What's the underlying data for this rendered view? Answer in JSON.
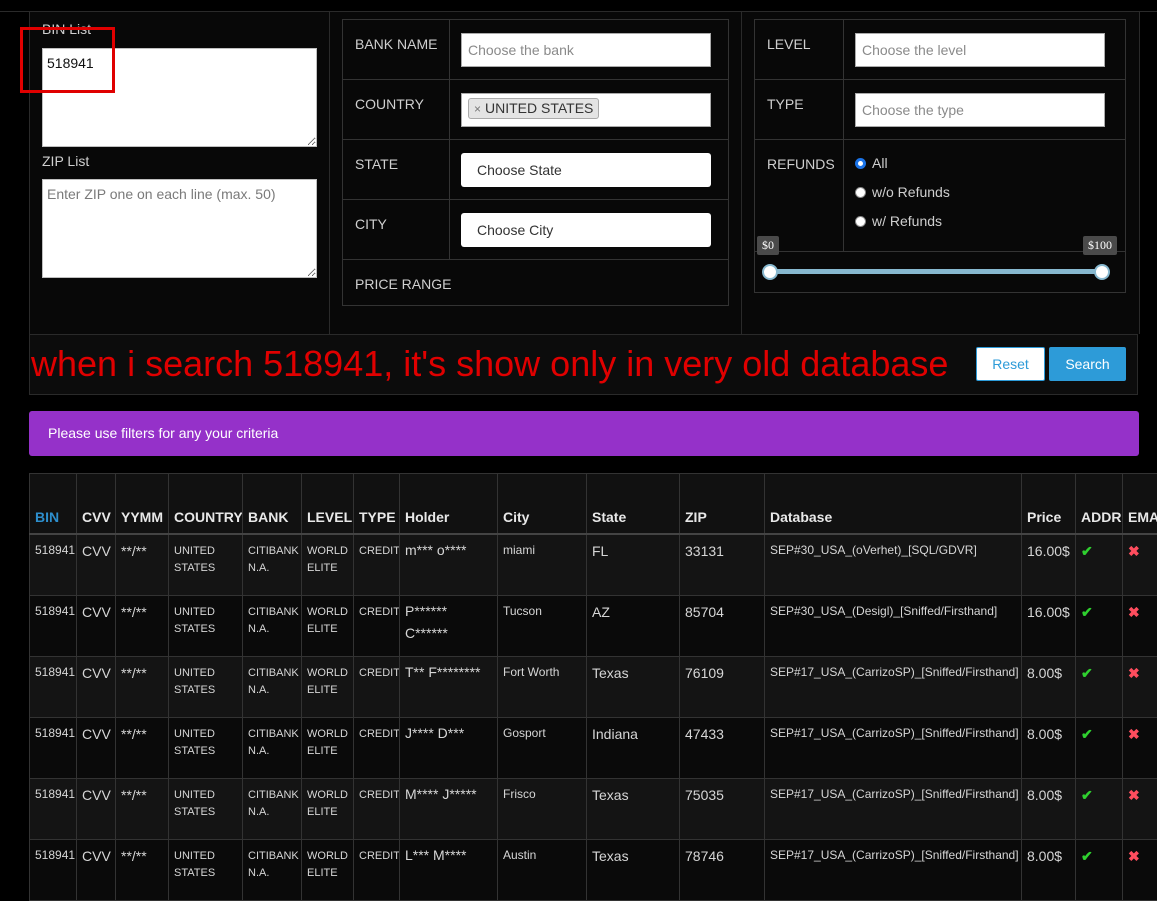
{
  "filters": {
    "bin_list_label": "BIN List",
    "bin_list_value": "518941",
    "zip_list_label": "ZIP List",
    "zip_list_placeholder": "Enter ZIP one on each line (max. 50)",
    "bank_name_label": "BANK NAME",
    "bank_name_placeholder": "Choose the bank",
    "country_label": "COUNTRY",
    "country_tag": "UNITED STATES",
    "country_tag_remove": "×",
    "state_label": "STATE",
    "state_select": "Choose State",
    "city_label": "CITY",
    "city_select": "Choose City",
    "price_range_label": "PRICE RANGE",
    "level_label": "LEVEL",
    "level_placeholder": "Choose the level",
    "type_label": "TYPE",
    "type_placeholder": "Choose the type",
    "refunds_label": "REFUNDS",
    "refund_options": [
      "All",
      "w/o Refunds",
      "w/ Refunds"
    ],
    "refund_selected": "All",
    "price_min_label": "$0",
    "price_max_label": "$100",
    "price_min_value": 0,
    "price_max_value": 100
  },
  "annotation_text": "when i search 518941, it's show only in very old database",
  "buttons": {
    "reset": "Reset",
    "search": "Search"
  },
  "notice": "Please use filters for any your criteria",
  "colors": {
    "accent_blue": "#2d9bd8",
    "notice_purple": "#9531c9",
    "annotation_red": "#e00000",
    "ok_green": "#2fd02f",
    "no_red": "#ff4d5e"
  },
  "table": {
    "headers": [
      "BIN",
      "CVV",
      "YYMM",
      "COUNTRY",
      "BANK",
      "LEVEL",
      "TYPE",
      "Holder",
      "City",
      "State",
      "ZIP",
      "Database",
      "Price",
      "ADDR",
      "EMA"
    ],
    "rows": [
      {
        "bin": "518941",
        "cvv": "CVV",
        "yymm": "**/**",
        "country_1": "UNITED",
        "country_2": "STATES",
        "bank_1": "CITIBANK",
        "bank_2": "N.A.",
        "level_1": "WORLD",
        "level_2": "ELITE",
        "type": "CREDIT",
        "holder": "m*** o****",
        "city": "miami",
        "state": "FL",
        "zip": "33131",
        "database": "SEP#30_USA_(oVerhet)_[SQL/GDVR]",
        "price": "16.00$",
        "addr": "✔",
        "email": "✖"
      },
      {
        "bin": "518941",
        "cvv": "CVV",
        "yymm": "**/**",
        "country_1": "UNITED",
        "country_2": "STATES",
        "bank_1": "CITIBANK",
        "bank_2": "N.A.",
        "level_1": "WORLD",
        "level_2": "ELITE",
        "type": "CREDIT",
        "holder": "P****** C******",
        "city": "Tucson",
        "state": "AZ",
        "zip": "85704",
        "database": "SEP#30_USA_(Desigl)_[Sniffed/Firsthand]",
        "price": "16.00$",
        "addr": "✔",
        "email": "✖"
      },
      {
        "bin": "518941",
        "cvv": "CVV",
        "yymm": "**/**",
        "country_1": "UNITED",
        "country_2": "STATES",
        "bank_1": "CITIBANK",
        "bank_2": "N.A.",
        "level_1": "WORLD",
        "level_2": "ELITE",
        "type": "CREDIT",
        "holder": "T** F********",
        "city": "Fort Worth",
        "state": "Texas",
        "zip": "76109",
        "database": "SEP#17_USA_(CarrizoSP)_[Sniffed/Firsthand]",
        "price": "8.00$",
        "addr": "✔",
        "email": "✖"
      },
      {
        "bin": "518941",
        "cvv": "CVV",
        "yymm": "**/**",
        "country_1": "UNITED",
        "country_2": "STATES",
        "bank_1": "CITIBANK",
        "bank_2": "N.A.",
        "level_1": "WORLD",
        "level_2": "ELITE",
        "type": "CREDIT",
        "holder": "J**** D***",
        "city": "Gosport",
        "state": "Indiana",
        "zip": "47433",
        "database": "SEP#17_USA_(CarrizoSP)_[Sniffed/Firsthand]",
        "price": "8.00$",
        "addr": "✔",
        "email": "✖"
      },
      {
        "bin": "518941",
        "cvv": "CVV",
        "yymm": "**/**",
        "country_1": "UNITED",
        "country_2": "STATES",
        "bank_1": "CITIBANK",
        "bank_2": "N.A.",
        "level_1": "WORLD",
        "level_2": "ELITE",
        "type": "CREDIT",
        "holder": "M**** J*****",
        "city": "Frisco",
        "state": "Texas",
        "zip": "75035",
        "database": "SEP#17_USA_(CarrizoSP)_[Sniffed/Firsthand]",
        "price": "8.00$",
        "addr": "✔",
        "email": "✖"
      },
      {
        "bin": "518941",
        "cvv": "CVV",
        "yymm": "**/**",
        "country_1": "UNITED",
        "country_2": "STATES",
        "bank_1": "CITIBANK",
        "bank_2": "N.A.",
        "level_1": "WORLD",
        "level_2": "ELITE",
        "type": "CREDIT",
        "holder": "L*** M****",
        "city": "Austin",
        "state": "Texas",
        "zip": "78746",
        "database": "SEP#17_USA_(CarrizoSP)_[Sniffed/Firsthand]",
        "price": "8.00$",
        "addr": "✔",
        "email": "✖"
      }
    ]
  }
}
